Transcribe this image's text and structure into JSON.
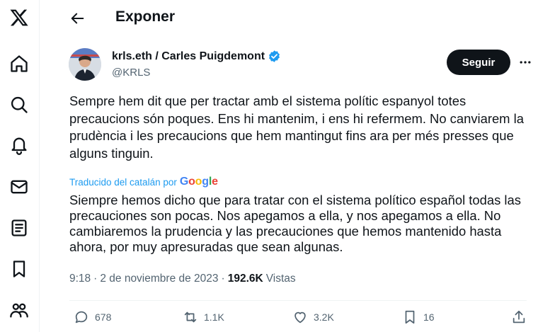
{
  "sidebar": {
    "items": [
      {
        "icon": "x-logo-icon"
      },
      {
        "icon": "home-icon"
      },
      {
        "icon": "search-icon"
      },
      {
        "icon": "notifications-bell-icon"
      },
      {
        "icon": "messages-envelope-icon"
      },
      {
        "icon": "lists-document-icon"
      },
      {
        "icon": "bookmark-icon"
      },
      {
        "icon": "communities-people-icon"
      }
    ]
  },
  "header": {
    "title": "Exponer"
  },
  "tweet": {
    "author_name": "krls.eth / Carles Puigdemont",
    "handle": "@KRLS",
    "follow_label": "Seguir",
    "text": "Sempre hem dit que per tractar amb el sistema polític espanyol totes precaucions són poques. Ens hi mantenim, i ens hi refermem. No canviarem la prudència i les precaucions que hem mantingut fins ara per més presses que alguns tinguin.",
    "translated_from": "Traducido del catalán por",
    "translation": "Siempre hemos dicho que para tratar con el sistema político español todas las precauciones son pocas. Nos apegamos a ella, y nos apegamos a ella. No cambiaremos la prudencia y las precauciones que hemos mantenido hasta ahora, por muy apresuradas que sean algunas.",
    "time": "9:18",
    "separator": "·",
    "date": "2 de noviembre de 2023",
    "views_count": "192.6K",
    "views_label": "Vistas",
    "replies": "678",
    "reposts": "1.1K",
    "likes": "3.2K",
    "bookmarks": "16"
  },
  "colors": {
    "accent": "#1d9bf0",
    "text": "#0f1419",
    "muted": "#536471",
    "follow_bg": "#0f1419"
  }
}
